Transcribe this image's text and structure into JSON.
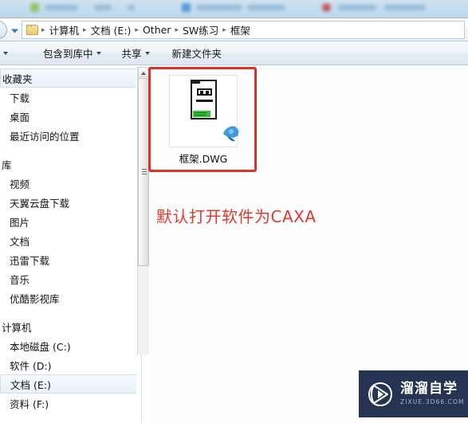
{
  "window": {
    "address_bar": {
      "folder_icon": "folder-icon",
      "dropdown_icon": "chevron-down-icon",
      "back_button_icon": "back-arrow-icon",
      "separator": "▸",
      "breadcrumbs": [
        "计算机",
        "文档 (E:)",
        "Other",
        "SW练习",
        "框架"
      ]
    },
    "toolbar": {
      "organize_caret_only": "",
      "items": [
        {
          "label": "包含到库中",
          "has_caret": true
        },
        {
          "label": "共享",
          "has_caret": true
        },
        {
          "label": "新建文件夹",
          "has_caret": false
        }
      ]
    }
  },
  "nav_pane": {
    "sections": [
      {
        "header": "收藏夹",
        "selected": true,
        "items": [
          "下载",
          "桌面",
          "最近访问的位置"
        ]
      },
      {
        "header": "库",
        "selected": false,
        "items": [
          "视频",
          "天翼云盘下载",
          "图片",
          "文档",
          "迅雷下载",
          "音乐",
          "优酷影视库"
        ]
      },
      {
        "header": "计算机",
        "selected": false,
        "items": [
          "本地磁盘 (C:)",
          "软件 (D:)",
          "文档 (E:)",
          "资料 (F:)"
        ]
      }
    ],
    "selected_item": "文档 (E:)",
    "scrollbar": {
      "up_arrow_icon": "scroll-up-arrow-icon",
      "grip_icon": "scrollbar-grip-icon"
    }
  },
  "content": {
    "files": [
      {
        "name": "框架.DWG",
        "thumbnail_icon": "dwg-drawing-thumbnail",
        "overlay_icon": "caxa-app-overlay-icon"
      }
    ],
    "annotation": "默认打开软件为CAXA",
    "highlight_box": {
      "color": "#e03127",
      "target": "框架.DWG"
    }
  },
  "watermark": {
    "logo_icon": "play-button-logo-icon",
    "title": "溜溜自学",
    "subtitle": "ZIXUE.3D66.COM",
    "background": "#273352"
  },
  "colors": {
    "annotation_red": "#e0392e",
    "selection_blue": "#e9f2fa",
    "watermark_navy": "#273352"
  }
}
